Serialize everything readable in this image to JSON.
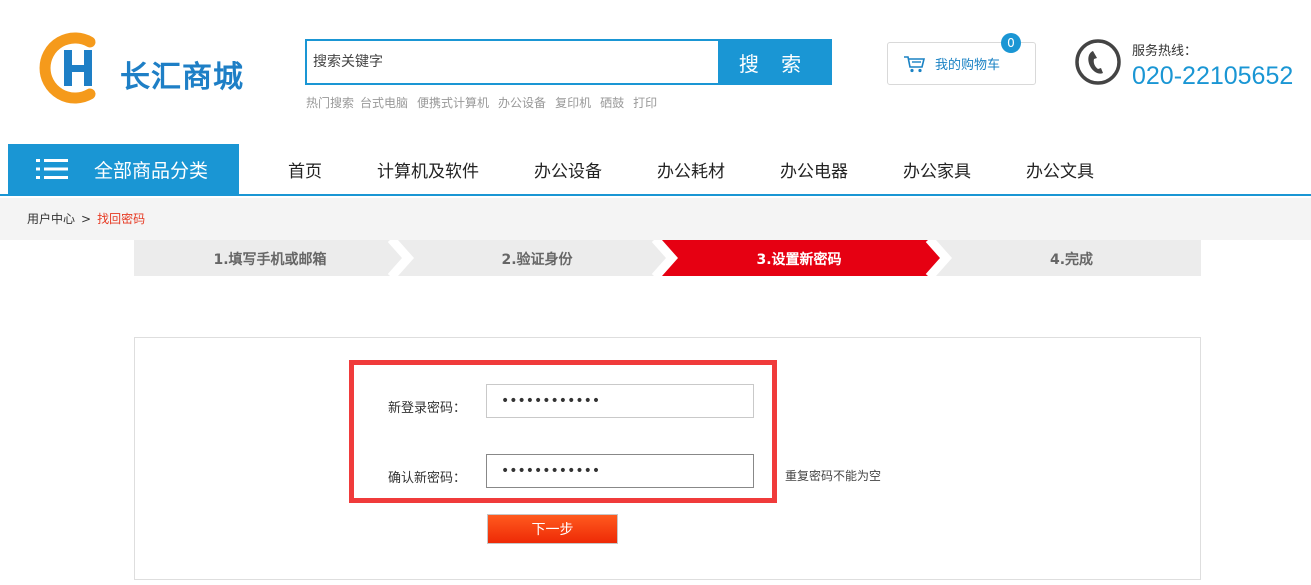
{
  "header": {
    "logo_text": "长汇商城",
    "search": {
      "placeholder": "搜索关键字",
      "button_label": "搜 索"
    },
    "hot_search": {
      "label": "热门搜索",
      "items": [
        "台式电脑",
        "便携式计算机",
        "办公设备",
        "复印机",
        "硒鼓",
        "打印"
      ]
    },
    "cart": {
      "label": "我的购物车",
      "count": "0"
    },
    "hotline": {
      "label": "服务热线：",
      "number": "020-22105652"
    }
  },
  "nav": {
    "all_categories": "全部商品分类",
    "items": [
      "首页",
      "计算机及软件",
      "办公设备",
      "办公耗材",
      "办公电器",
      "办公家具",
      "办公文具"
    ]
  },
  "breadcrumb": {
    "root": "用户中心",
    "separator": ">",
    "current": "找回密码"
  },
  "steps": [
    {
      "label": "1.填写手机或邮箱",
      "active": false
    },
    {
      "label": "2.验证身份",
      "active": false
    },
    {
      "label": "3.设置新密码",
      "active": true
    },
    {
      "label": "4.完成",
      "active": false
    }
  ],
  "form": {
    "new_password_label": "新登录密码：",
    "new_password_value": "••••••••••••",
    "confirm_password_label": "确认新密码：",
    "confirm_password_value": "••••••••••••",
    "confirm_error": "重复密码不能为空",
    "next_button": "下一步"
  },
  "colors": {
    "brand_blue": "#1a96d4",
    "step_active": "#e60012",
    "step_inactive": "#ececec",
    "highlight_border": "#f03b3b",
    "next_button": "#f2380e"
  }
}
